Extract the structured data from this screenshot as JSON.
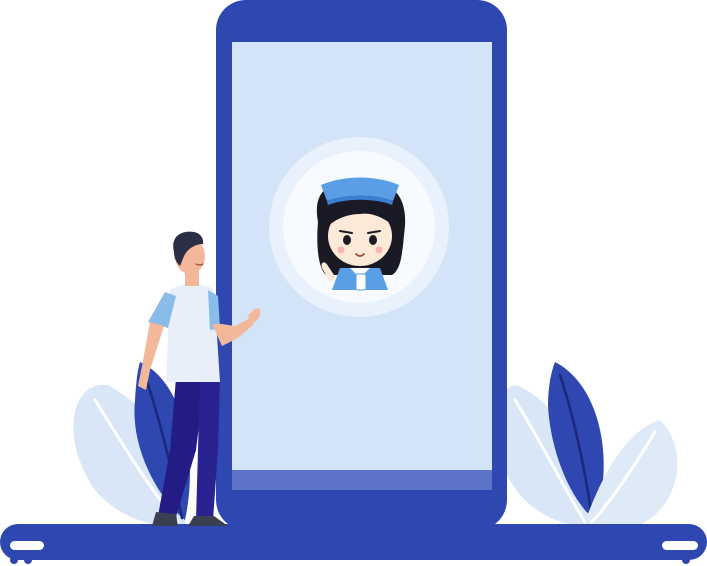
{
  "illustration": {
    "subject": "",
    "colors": {
      "phone_body": "#2e47b1",
      "phone_screen": "#d3e3f8",
      "screen_bottom_bar": "#5c73c8",
      "ground": "#2e47b1",
      "avatar_ring_outer": "#e8f1fc",
      "avatar_ring_inner": "#f7fbff",
      "nurse_cap": "#5a9ee6",
      "nurse_hair": "#1a1a26",
      "nurse_skin": "#fde9d8",
      "nurse_uniform": "#5a9ee6",
      "man_shirt": "#e9eff8",
      "man_sleeves": "#89bce8",
      "man_pants": "#241c85",
      "man_skin": "#f3b89a",
      "man_hair": "#2a2f45",
      "leaf_light": "#d8e6f8",
      "leaf_dark": "#2e47b1"
    },
    "icons": [
      "smartphone-icon",
      "nurse-avatar-icon",
      "man-figure-icon",
      "leaf-icon"
    ]
  }
}
